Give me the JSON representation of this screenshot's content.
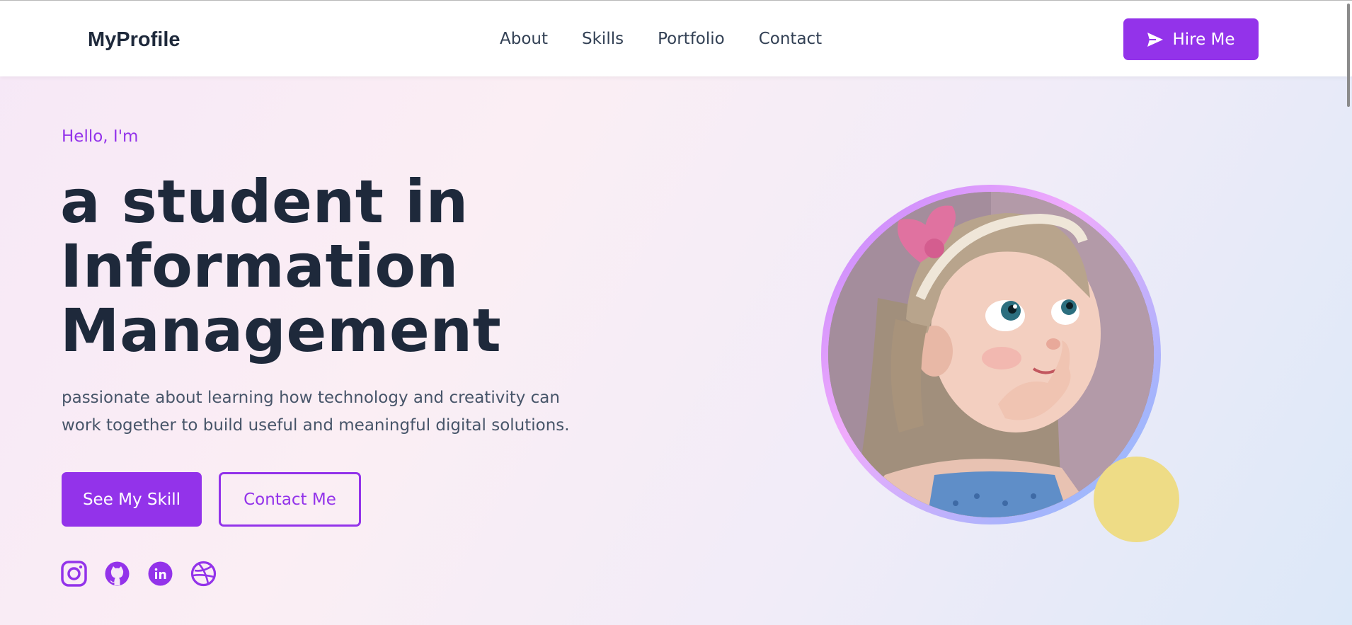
{
  "header": {
    "brand": "MyProfile",
    "nav": [
      "About",
      "Skills",
      "Portfolio",
      "Contact"
    ],
    "hire_label": "Hire Me"
  },
  "hero": {
    "greeting": "Hello, I'm",
    "headline": [
      "a student in",
      "Information",
      "Management"
    ],
    "description": "passionate about learning how technology and creativity can work together to build useful and meaningful digital solutions.",
    "primary_button": "See My Skill",
    "secondary_button": "Contact Me",
    "social_icons": [
      "instagram-icon",
      "github-icon",
      "linkedin-icon",
      "dribbble-icon"
    ]
  },
  "colors": {
    "accent": "#9333ea",
    "text_dark": "#1e293b",
    "text_muted": "#475569",
    "decor_yellow": "#eedc86"
  },
  "avatar": {
    "icon": "cartoon-girl-avatar"
  }
}
